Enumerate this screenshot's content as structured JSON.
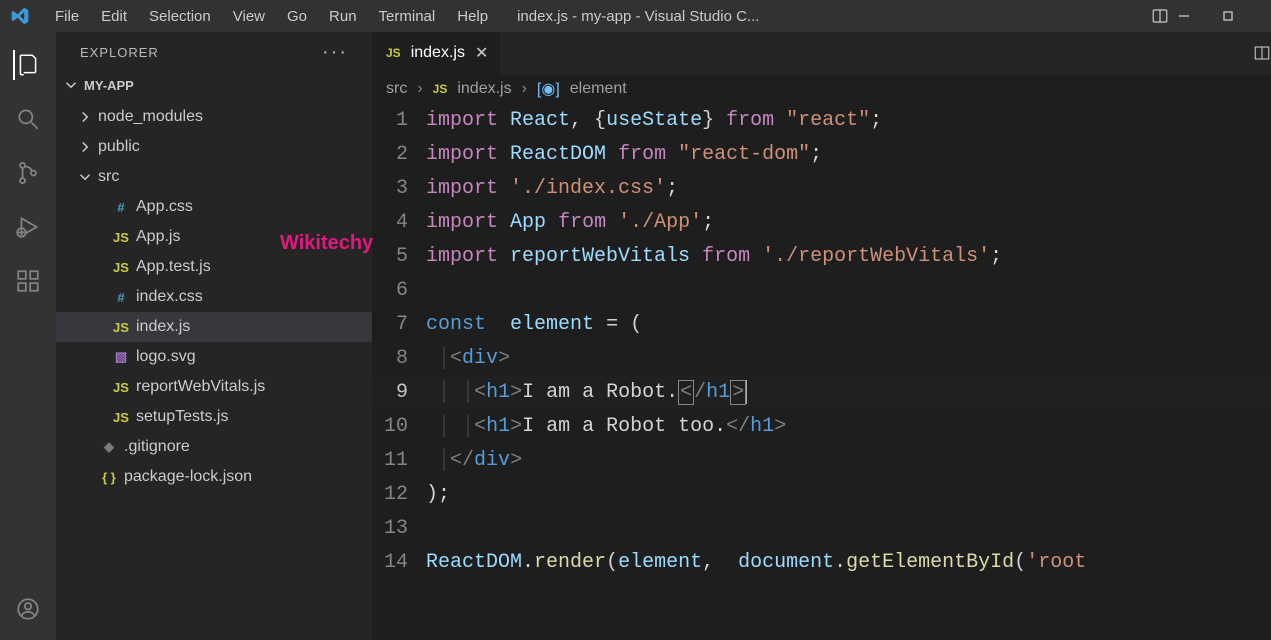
{
  "titlebar": {
    "menu": [
      "File",
      "Edit",
      "Selection",
      "View",
      "Go",
      "Run",
      "Terminal",
      "Help"
    ],
    "title": "index.js - my-app - Visual Studio C..."
  },
  "activity": {
    "items": [
      "files-icon",
      "search-icon",
      "source-control-icon",
      "run-debug-icon",
      "extensions-icon"
    ],
    "bottom": [
      "account-icon"
    ]
  },
  "sidebar": {
    "title": "EXPLORER",
    "project": "MY-APP",
    "tree": [
      {
        "type": "folder",
        "name": "node_modules",
        "expanded": false,
        "indent": 0
      },
      {
        "type": "folder",
        "name": "public",
        "expanded": false,
        "indent": 0
      },
      {
        "type": "folder",
        "name": "src",
        "expanded": true,
        "indent": 0
      },
      {
        "type": "file",
        "name": "App.css",
        "icon": "css",
        "indent": 1
      },
      {
        "type": "file",
        "name": "App.js",
        "icon": "js",
        "indent": 1
      },
      {
        "type": "file",
        "name": "App.test.js",
        "icon": "js",
        "indent": 1
      },
      {
        "type": "file",
        "name": "index.css",
        "icon": "css",
        "indent": 1
      },
      {
        "type": "file",
        "name": "index.js",
        "icon": "js",
        "indent": 1,
        "selected": true
      },
      {
        "type": "file",
        "name": "logo.svg",
        "icon": "svg",
        "indent": 1
      },
      {
        "type": "file",
        "name": "reportWebVitals.js",
        "icon": "js",
        "indent": 1
      },
      {
        "type": "file",
        "name": "setupTests.js",
        "icon": "js",
        "indent": 1
      },
      {
        "type": "file",
        "name": ".gitignore",
        "icon": "git",
        "indent": 0
      },
      {
        "type": "file",
        "name": "package-lock.json",
        "icon": "lock",
        "indent": 0
      }
    ]
  },
  "watermark": "Wikitechy",
  "tab": {
    "icon": "JS",
    "label": "index.js"
  },
  "breadcrumb": {
    "path": "src",
    "fileIcon": "JS",
    "file": "index.js",
    "symbol": "element"
  },
  "code": {
    "lines": [
      {
        "n": 1,
        "html": "<span class='tk-kw'>import</span> <span class='tk-var'>React</span><span class='tk-pun'>, {</span><span class='tk-var'>useState</span><span class='tk-pun'>}</span> <span class='tk-kw'>from</span> <span class='tk-str'>\"react\"</span><span class='tk-pun'>;</span>"
      },
      {
        "n": 2,
        "html": "<span class='tk-kw'>import</span> <span class='tk-var'>ReactDOM</span> <span class='tk-kw'>from</span> <span class='tk-str'>\"react-dom\"</span><span class='tk-pun'>;</span>"
      },
      {
        "n": 3,
        "html": "<span class='tk-kw'>import</span> <span class='tk-str'>'./index.css'</span><span class='tk-pun'>;</span>"
      },
      {
        "n": 4,
        "html": "<span class='tk-kw'>import</span> <span class='tk-var'>App</span> <span class='tk-kw'>from</span> <span class='tk-str'>'./App'</span><span class='tk-pun'>;</span>"
      },
      {
        "n": 5,
        "html": "<span class='tk-kw'>import</span> <span class='tk-var'>reportWebVitals</span> <span class='tk-kw'>from</span> <span class='tk-str'>'./reportWebVitals'</span><span class='tk-pun'>;</span>"
      },
      {
        "n": 6,
        "html": ""
      },
      {
        "n": 7,
        "html": "<span class='tk-def'>const</span>  <span class='tk-var'>element</span> <span class='tk-pun'>=</span> <span class='tk-pun'>(</span>"
      },
      {
        "n": 8,
        "html": " <span class='indent-guide'>│</span><span class='tk-brk'>&lt;</span><span class='tk-tag'>div</span><span class='tk-brk'>&gt;</span>"
      },
      {
        "n": 9,
        "current": true,
        "html": " <span class='indent-guide'>│</span> <span class='indent-guide'>│</span><span class='tk-brk'>&lt;</span><span class='tk-tag'>h1</span><span class='tk-brk'>&gt;</span><span class='tk-txt'>I am a Robot.</span><span class='box-bracket tk-brk'>&lt;</span><span class='tk-brk'>/</span><span class='tk-tag'>h1</span><span class='box-bracket tk-brk'>&gt;</span><span class='cursor'></span>"
      },
      {
        "n": 10,
        "html": " <span class='indent-guide'>│</span> <span class='indent-guide'>│</span><span class='tk-brk'>&lt;</span><span class='tk-tag'>h1</span><span class='tk-brk'>&gt;</span><span class='tk-txt'>I am a Robot too.</span><span class='tk-brk'>&lt;/</span><span class='tk-tag'>h1</span><span class='tk-brk'>&gt;</span>"
      },
      {
        "n": 11,
        "html": " <span class='indent-guide'>│</span><span class='tk-brk'>&lt;/</span><span class='tk-tag'>div</span><span class='tk-brk'>&gt;</span>"
      },
      {
        "n": 12,
        "html": "<span class='tk-pun'>);</span>"
      },
      {
        "n": 13,
        "html": ""
      },
      {
        "n": 14,
        "html": "<span class='tk-var'>ReactDOM</span><span class='tk-pun'>.</span><span class='tk-fn'>render</span><span class='tk-pun'>(</span><span class='tk-var'>element</span><span class='tk-pun'>,</span>  <span class='tk-var'>document</span><span class='tk-pun'>.</span><span class='tk-fn'>getElementById</span><span class='tk-pun'>(</span><span class='tk-str'>'root</span>"
      }
    ]
  }
}
